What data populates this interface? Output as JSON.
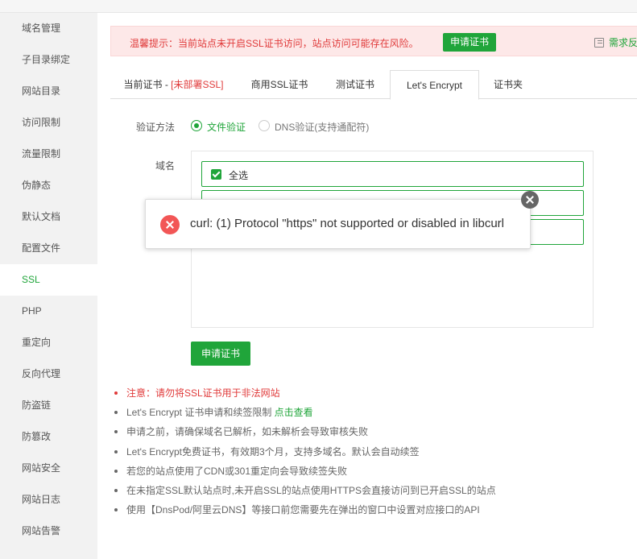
{
  "sidebar": {
    "items": [
      {
        "label": "域名管理"
      },
      {
        "label": "子目录绑定"
      },
      {
        "label": "网站目录"
      },
      {
        "label": "访问限制"
      },
      {
        "label": "流量限制"
      },
      {
        "label": "伪静态"
      },
      {
        "label": "默认文档"
      },
      {
        "label": "配置文件"
      },
      {
        "label": "SSL"
      },
      {
        "label": "PHP"
      },
      {
        "label": "重定向"
      },
      {
        "label": "反向代理"
      },
      {
        "label": "防盗链"
      },
      {
        "label": "防篡改"
      },
      {
        "label": "网站安全"
      },
      {
        "label": "网站日志"
      },
      {
        "label": "网站告警"
      }
    ],
    "active": "SSL"
  },
  "warning": {
    "text": "温馨提示：当前站点未开启SSL证书访问，站点访问可能存在风险。",
    "button": "申请证书",
    "feedback": "需求反"
  },
  "tabs": {
    "current_prefix": "当前证书 - ",
    "current_status": "[未部署SSL]",
    "commercial": "商用SSL证书",
    "test": "测试证书",
    "letsencrypt": "Let's Encrypt",
    "folder": "证书夹"
  },
  "form": {
    "verify_label": "验证方法",
    "file_verify": "文件验证",
    "dns_verify": "DNS验证(支持通配符)",
    "domain_label": "域名",
    "select_all": "全选",
    "apply_button": "申请证书"
  },
  "notes": {
    "n1": "注意：请勿将SSL证书用于非法网站",
    "n2_text": "Let's Encrypt 证书申请和续签限制 ",
    "n2_link": "点击查看",
    "n3": "申请之前，请确保域名已解析，如未解析会导致审核失败",
    "n4": "Let's Encrypt免费证书，有效期3个月，支持多域名。默认会自动续签",
    "n5": "若您的站点使用了CDN或301重定向会导致续签失败",
    "n6": "在未指定SSL默认站点时,未开启SSL的站点使用HTTPS会直接访问到已开启SSL的站点",
    "n7": "使用【DnsPod/阿里云DNS】等接口前您需要先在弹出的窗口中设置对应接口的API"
  },
  "toast": {
    "message": "curl: (1) Protocol \"https\" not supported or disabled in libcurl"
  },
  "colors": {
    "accent": "#20a53a",
    "danger": "#e03a3a",
    "warning_bg": "#fde8e8",
    "sidebar_bg": "#f2f2f2"
  }
}
